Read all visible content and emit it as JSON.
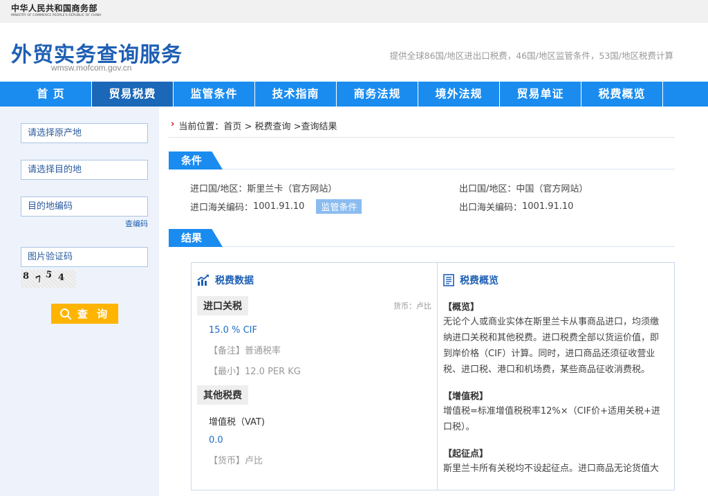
{
  "ministry": {
    "name_cn": "中华人民共和国商务部",
    "name_en": "MINISTRY OF COMMERCE PEOPLE'S REPUBLIC OF CHINA"
  },
  "site": {
    "title": "外贸实务查询服务",
    "url": "wmsw.mofcom.gov.cn",
    "slogan": "提供全球86国/地区进出口税费，46国/地区监管条件，53国/地区税费计算"
  },
  "nav": {
    "items": [
      "首 页",
      "贸易税费",
      "监管条件",
      "技术指南",
      "商务法规",
      "境外法规",
      "贸易单证",
      "税费概览"
    ],
    "active_index": 1
  },
  "sidebar": {
    "origin_placeholder": "请选择原产地",
    "destination_placeholder": "请选择目的地",
    "code_placeholder": "目的地编码",
    "lookup_code_link": "查编码",
    "captcha_placeholder": "图片验证码",
    "captcha_chars": [
      "8",
      "7",
      "5",
      "4"
    ],
    "query_button": "查 询"
  },
  "breadcrumb": {
    "prefix": "当前位置：",
    "path": "首页 > 税费查询 >查询结果"
  },
  "conditions": {
    "section_title": "条件",
    "import_country_label": "进口国/地区：",
    "import_country": "斯里兰卡（官方网站）",
    "export_country_label": "出口国/地区：",
    "export_country": "中国（官方网站）",
    "import_code_label": "进口海关编码：",
    "import_code": "1001.91.10",
    "regulation_badge": "监管条件",
    "export_code_label": "出口海关编码：",
    "export_code": "1001.91.10"
  },
  "result": {
    "section_title": "结果",
    "tax_data": {
      "heading": "税费数据",
      "import_duty_tag": "进口关税",
      "currency_note": "货币：卢比",
      "rate": "15.0 % CIF",
      "remark": "【备注】普通税率",
      "minimum": "【最小】12.0 PER KG",
      "other_tax_tag": "其他税费",
      "vat_label": "增值税（VAT)",
      "vat_value": "0.0",
      "vat_currency": "【货币】卢比"
    },
    "overview": {
      "heading": "税费概览",
      "p1_title": "【概览】",
      "p1_text": "无论个人或商业实体在斯里兰卡从事商品进口，均须缴纳进口关税和其他税费。进口税费全部以货运价值，即到岸价格（CIF）计算。同时，进口商品还须征收营业税、进口税、港口和机场费，某些商品征收消费税。",
      "p2_title": "【增值税】",
      "p2_text": "增值税=标准增值税税率12%×（CIF价+适用关税+进口税）。",
      "p3_title": "【起征点】",
      "p3_text": "斯里兰卡所有关税均不设起征点。进口商品无论货值大"
    }
  },
  "colors": {
    "nav_blue": "#1a8cf0",
    "nav_active": "#1b67b8",
    "title_blue": "#1e5fb4",
    "query_orange": "#ffb400",
    "crumb_red": "#c8161d"
  }
}
